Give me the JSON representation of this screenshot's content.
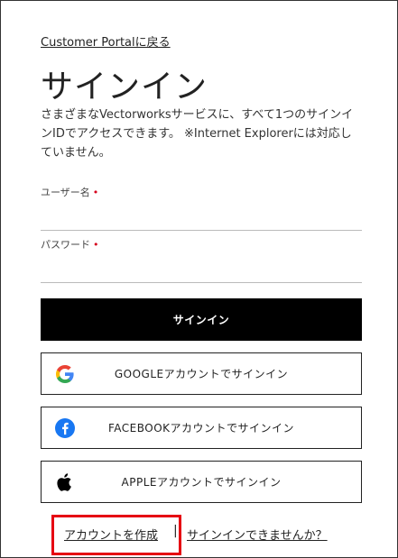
{
  "nav": {
    "back_label": "Customer Portalに戻る"
  },
  "header": {
    "title": "サインイン",
    "description": "さまざまなVectorworksサービスに、すべて1つのサインインIDでアクセスできます。 ※Internet Explorerには対応していません。"
  },
  "form": {
    "username_label": "ユーザー名",
    "password_label": "パスワード",
    "required_mark": "•",
    "username_value": "",
    "password_value": "",
    "signin_label": "サインイン"
  },
  "social": {
    "google_label": "GOOGLEアカウントでサインイン",
    "facebook_label": "FACEBOOKアカウントでサインイン",
    "apple_label": "APPLEアカウントでサインイン"
  },
  "footer": {
    "create_label": "アカウントを作成",
    "separator": "|",
    "help_label": "サインインできませんか？",
    "highlight_color": "#e60012"
  },
  "icons": {
    "google": "google-icon",
    "facebook": "facebook-icon",
    "apple": "apple-icon"
  },
  "colors": {
    "primary_button": "#000000",
    "facebook_blue": "#1877f2"
  }
}
